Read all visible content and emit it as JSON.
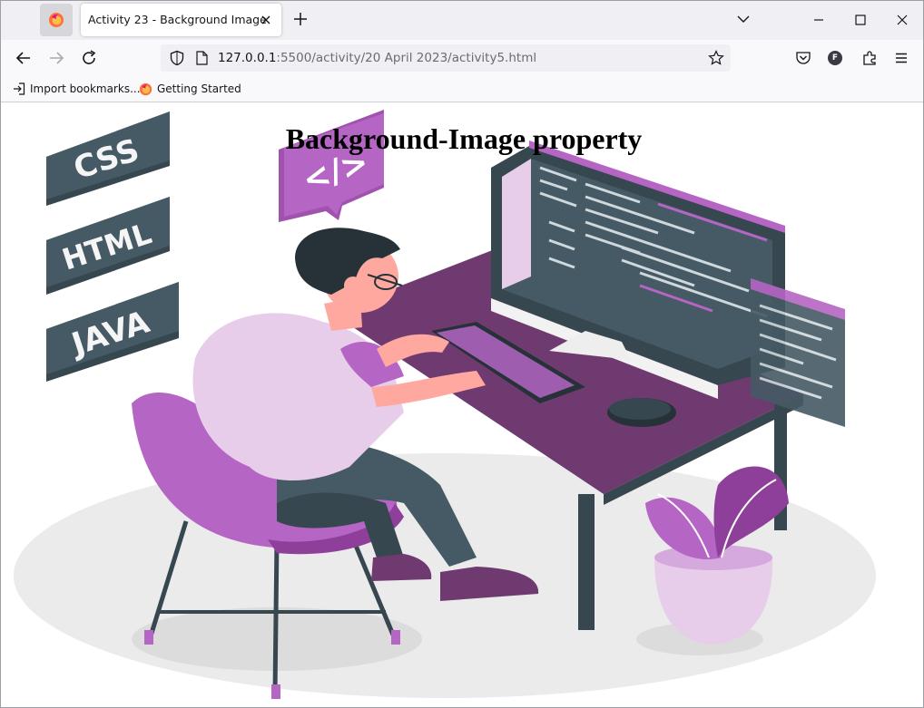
{
  "browser": {
    "tab_title": "Activity 23 - Background Image",
    "url_host": "127.0.0.1",
    "url_path": ":5500/activity/20 April 2023/activity5.html",
    "profile_initial": "F"
  },
  "bookmarks": [
    {
      "label": "Import bookmarks..."
    },
    {
      "label": "Getting Started"
    }
  ],
  "page": {
    "heading": "Background-Image property",
    "illustration_labels": [
      "CSS",
      "HTML",
      "JAVA"
    ],
    "code_icon_text": "</>"
  },
  "colors": {
    "purple": "#b565c4",
    "dark_purple": "#6f3a70",
    "light_purple": "#e7cdea",
    "slate": "#37474f",
    "ground": "#ebebeb"
  }
}
